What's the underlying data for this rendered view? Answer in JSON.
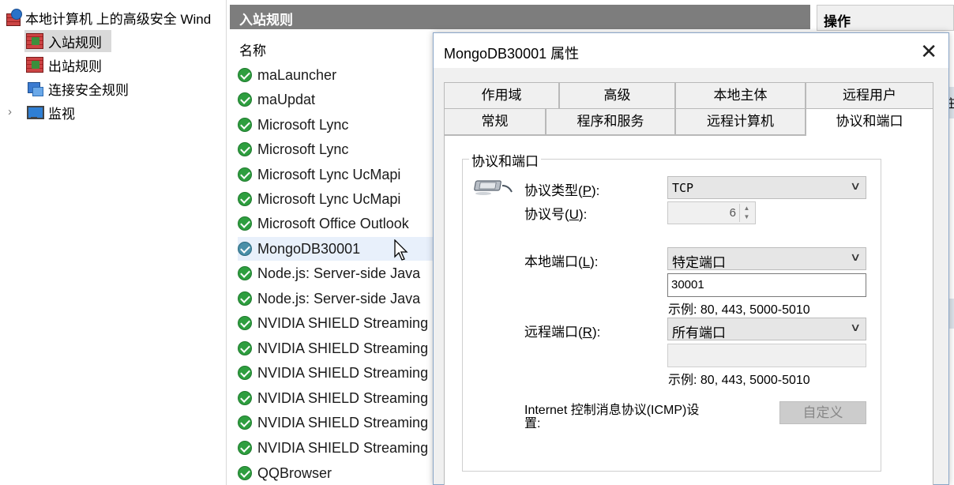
{
  "tree": {
    "root_label": "本地计算机 上的高级安全 Wind",
    "items": [
      {
        "label": "入站规则"
      },
      {
        "label": "出站规则"
      },
      {
        "label": "连接安全规则"
      },
      {
        "label": "监视"
      }
    ],
    "expand_glyph": "›"
  },
  "list": {
    "header": "入站规则",
    "column": "名称",
    "rows": [
      {
        "name": "maLauncher"
      },
      {
        "name": "maUpdat"
      },
      {
        "name": "Microsoft Lync"
      },
      {
        "name": "Microsoft Lync"
      },
      {
        "name": "Microsoft Lync UcMapi"
      },
      {
        "name": "Microsoft Lync UcMapi"
      },
      {
        "name": "Microsoft Office Outlook"
      },
      {
        "name": "MongoDB30001"
      },
      {
        "name": "Node.js: Server-side Java"
      },
      {
        "name": "Node.js: Server-side Java"
      },
      {
        "name": "NVIDIA SHIELD Streaming"
      },
      {
        "name": "NVIDIA SHIELD Streaming"
      },
      {
        "name": "NVIDIA SHIELD Streaming"
      },
      {
        "name": "NVIDIA SHIELD Streaming"
      },
      {
        "name": "NVIDIA SHIELD Streaming"
      },
      {
        "name": "NVIDIA SHIELD Streaming"
      },
      {
        "name": "QQBrowser"
      }
    ]
  },
  "actions": {
    "header": "操作",
    "partial_glyph": "庄"
  },
  "dialog": {
    "title": "MongoDB30001 属性",
    "close_glyph": "✕",
    "tabs_row1": [
      "作用域",
      "高级",
      "本地主体",
      "远程用户"
    ],
    "tabs_row2": [
      "常规",
      "程序和服务",
      "远程计算机",
      "协议和端口"
    ],
    "active_tab": "协议和端口",
    "group_title": "协议和端口",
    "protocol_type": {
      "label_pre": "协议类型(",
      "key": "P",
      "label_post": "):",
      "value": "TCP"
    },
    "protocol_number": {
      "label_pre": "协议号(",
      "key": "U",
      "label_post": "):",
      "value": "6"
    },
    "local_port": {
      "label_pre": "本地端口(",
      "key": "L",
      "label_post": "):",
      "mode": "特定端口",
      "value": "30001",
      "hint": "示例: 80, 443, 5000-5010"
    },
    "remote_port": {
      "label_pre": "远程端口(",
      "key": "R",
      "label_post": "):",
      "mode": "所有端口",
      "value": "",
      "hint": "示例: 80, 443, 5000-5010"
    },
    "icmp": {
      "label_line1": "Internet 控制消息协议(ICMP)设",
      "label_line2": "置:",
      "button": "自定义"
    },
    "chevron": "∨",
    "spin_up": "▲",
    "spin_down": "▼"
  }
}
